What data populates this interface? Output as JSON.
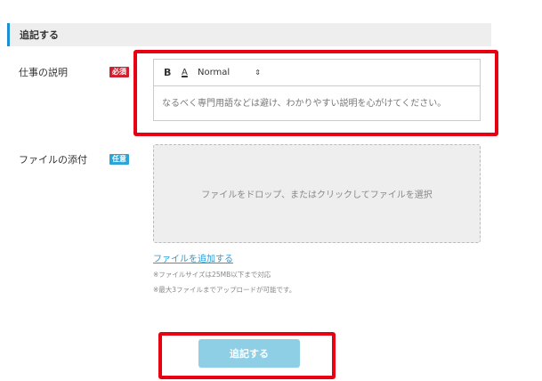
{
  "section": {
    "title": "追記する"
  },
  "job_description": {
    "label": "仕事の説明",
    "badge": "必須",
    "toolbar": {
      "bold": "B",
      "color": "A",
      "format_select": "Normal",
      "format_arrow": "⇕"
    },
    "placeholder": "なるべく専門用語などは避け、わかりやすい説明を心がけてください。"
  },
  "attachment": {
    "label": "ファイルの添付",
    "badge": "任意",
    "dropzone_text": "ファイルをドロップ、またはクリックしてファイルを選択",
    "add_link": "ファイルを追加する",
    "note_size": "※ファイルサイズは25MB以下まで対応",
    "note_count": "※最大3ファイルまでアップロードが可能です。"
  },
  "submit": {
    "label": "追記する"
  },
  "colors": {
    "accent": "#1e8fd1",
    "required_badge": "#d01f2f",
    "optional_badge": "#2ba4d9",
    "highlight": "#e60012",
    "submit_bg": "#8fcfe6",
    "link": "#2a9bd8"
  }
}
